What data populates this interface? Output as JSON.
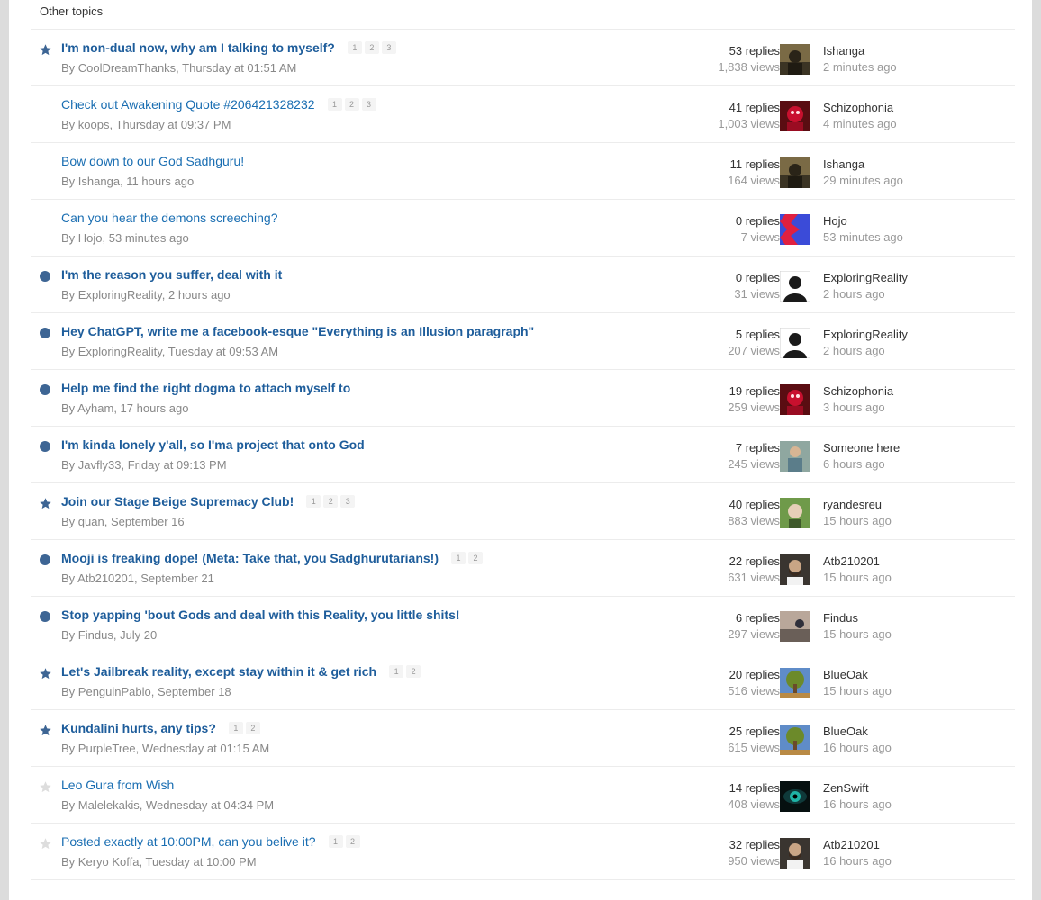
{
  "section": {
    "title": "Other topics"
  },
  "colors": {
    "link": "#1a6eb2",
    "unread_dot": "#3d6594",
    "star_filled": "#3d6594",
    "star_empty": "#dddddd"
  },
  "topics": [
    {
      "status": "star",
      "unread": true,
      "title": "I'm non-dual now, why am I talking to myself?",
      "pages": [
        "1",
        "2",
        "3"
      ],
      "author": "CoolDreamThanks",
      "date": "Thursday at 01:51 AM",
      "replies": "53 replies",
      "views": "1,838 views",
      "last_user": "Ishanga",
      "last_time": "2 minutes ago",
      "avatar": "portrait-dark"
    },
    {
      "status": "none",
      "unread": false,
      "title": "Check out Awakening Quote #206421328232",
      "pages": [
        "1",
        "2",
        "3"
      ],
      "author": "koops",
      "date": "Thursday at 09:37 PM",
      "replies": "41 replies",
      "views": "1,003 views",
      "last_user": "Schizophonia",
      "last_time": "4 minutes ago",
      "avatar": "red-figure"
    },
    {
      "status": "none",
      "unread": false,
      "title": "Bow down to our God Sadhguru!",
      "pages": [],
      "author": "Ishanga",
      "date": "11 hours ago",
      "replies": "11 replies",
      "views": "164 views",
      "last_user": "Ishanga",
      "last_time": "29 minutes ago",
      "avatar": "portrait-dark"
    },
    {
      "status": "none",
      "unread": false,
      "title": "Can you hear the demons screeching?",
      "pages": [],
      "author": "Hojo",
      "date": "53 minutes ago",
      "replies": "0 replies",
      "views": "7 views",
      "last_user": "Hojo",
      "last_time": "53 minutes ago",
      "avatar": "zigzag"
    },
    {
      "status": "dot",
      "unread": true,
      "title": "I'm the reason you suffer, deal with it",
      "pages": [],
      "author": "ExploringReality",
      "date": "2 hours ago",
      "replies": "0 replies",
      "views": "31 views",
      "last_user": "ExploringReality",
      "last_time": "2 hours ago",
      "avatar": "default"
    },
    {
      "status": "dot",
      "unread": true,
      "title": "Hey ChatGPT, write me a facebook-esque \"Everything is an Illusion paragraph\"",
      "pages": [],
      "author": "ExploringReality",
      "date": "Tuesday at 09:53 AM",
      "replies": "5 replies",
      "views": "207 views",
      "last_user": "ExploringReality",
      "last_time": "2 hours ago",
      "avatar": "default"
    },
    {
      "status": "dot",
      "unread": true,
      "title": "Help me find the right dogma to attach myself to",
      "pages": [],
      "author": "Ayham",
      "date": "17 hours ago",
      "replies": "19 replies",
      "views": "259 views",
      "last_user": "Schizophonia",
      "last_time": "3 hours ago",
      "avatar": "red-figure"
    },
    {
      "status": "dot",
      "unread": true,
      "title": "I'm kinda lonely y'all, so I'ma project that onto God",
      "pages": [],
      "author": "Javfly33",
      "date": "Friday at 09:13 PM",
      "replies": "7 replies",
      "views": "245 views",
      "last_user": "Someone here",
      "last_time": "6 hours ago",
      "avatar": "portrait-light"
    },
    {
      "status": "star",
      "unread": true,
      "title": "Join our Stage Beige Supremacy Club!",
      "pages": [
        "1",
        "2",
        "3"
      ],
      "author": "quan",
      "date": "September 16",
      "replies": "40 replies",
      "views": "883 views",
      "last_user": "ryandesreu",
      "last_time": "15 hours ago",
      "avatar": "outdoor-face"
    },
    {
      "status": "dot",
      "unread": true,
      "title": "Mooji is freaking dope! (Meta: Take that, you Sadghurutarians!)",
      "pages": [
        "1",
        "2"
      ],
      "author": "Atb210201",
      "date": "September 21",
      "replies": "22 replies",
      "views": "631 views",
      "last_user": "Atb210201",
      "last_time": "15 hours ago",
      "avatar": "portrait-beard"
    },
    {
      "status": "dot",
      "unread": true,
      "title": "Stop yapping 'bout Gods and deal with this Reality, you little shits!",
      "pages": [],
      "author": "Findus",
      "date": "July 20",
      "replies": "6 replies",
      "views": "297 views",
      "last_user": "Findus",
      "last_time": "15 hours ago",
      "avatar": "landscape"
    },
    {
      "status": "star",
      "unread": true,
      "title": "Let's Jailbreak reality, except stay within it & get rich",
      "pages": [
        "1",
        "2"
      ],
      "author": "PenguinPablo",
      "date": "September 18",
      "replies": "20 replies",
      "views": "516 views",
      "last_user": "BlueOak",
      "last_time": "15 hours ago",
      "avatar": "tree"
    },
    {
      "status": "star",
      "unread": true,
      "title": "Kundalini hurts, any tips?",
      "pages": [
        "1",
        "2"
      ],
      "author": "PurpleTree",
      "date": "Wednesday at 01:15 AM",
      "replies": "25 replies",
      "views": "615 views",
      "last_user": "BlueOak",
      "last_time": "16 hours ago",
      "avatar": "tree"
    },
    {
      "status": "star-empty",
      "unread": false,
      "title": "Leo Gura from Wish",
      "pages": [],
      "author": "Malelekakis",
      "date": "Wednesday at 04:34 PM",
      "replies": "14 replies",
      "views": "408 views",
      "last_user": "ZenSwift",
      "last_time": "16 hours ago",
      "avatar": "eye"
    },
    {
      "status": "star-empty",
      "unread": false,
      "title": "Posted exactly at 10:00PM, can you belive it?",
      "pages": [
        "1",
        "2"
      ],
      "author": "Keryo Koffa",
      "date": "Tuesday at 10:00 PM",
      "replies": "32 replies",
      "views": "950 views",
      "last_user": "Atb210201",
      "last_time": "16 hours ago",
      "avatar": "portrait-beard"
    }
  ]
}
